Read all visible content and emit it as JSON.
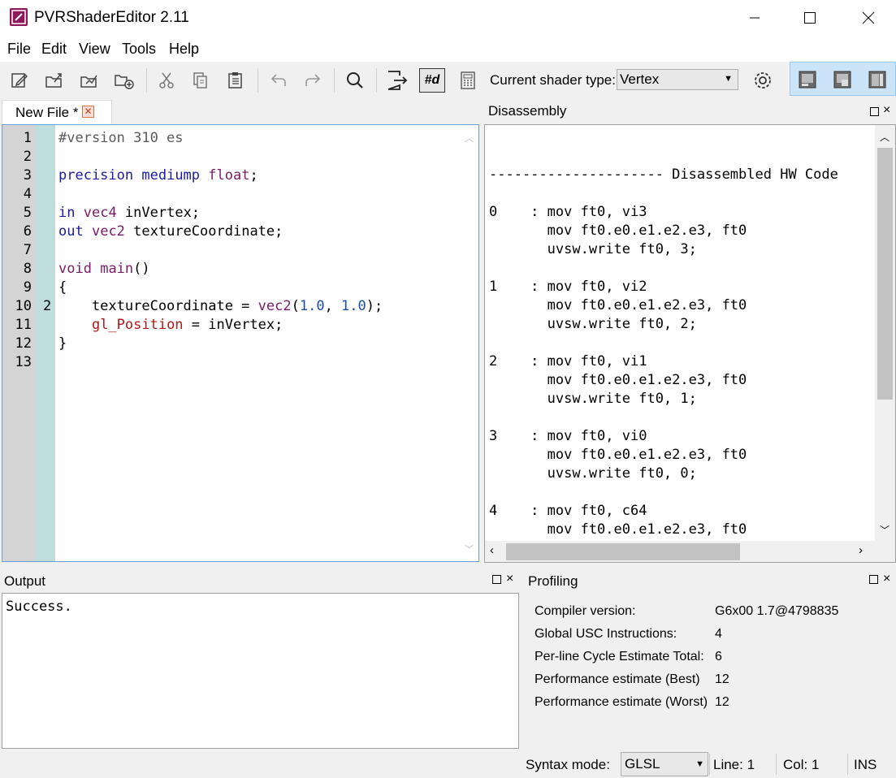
{
  "app": {
    "title": "PVRShaderEditor 2.11"
  },
  "menu": [
    "File",
    "Edit",
    "View",
    "Tools",
    "Help"
  ],
  "toolbar": {
    "icons": [
      "new-file-icon",
      "open-file-icon",
      "open-folder-icon",
      "add-file-icon",
      "cut-icon",
      "copy-icon",
      "paste-icon",
      "undo-icon",
      "redo-icon",
      "search-icon",
      "export-icon",
      "define-icon",
      "calculator-icon",
      "gear-icon",
      "layout-left-icon",
      "layout-split-icon",
      "layout-right-icon"
    ],
    "shader_type_label": "Current shader type:",
    "shader_type_value": "Vertex",
    "define_label": "#d"
  },
  "editor": {
    "tab_label": "New File *",
    "line_numbers": [
      "1",
      "2",
      "3",
      "4",
      "5",
      "6",
      "7",
      "8",
      "9",
      "10",
      "11",
      "12",
      "13"
    ],
    "cycle_marker": {
      "line": "10",
      "value": "2"
    }
  },
  "disassembly": {
    "title": "Disassembled HW Code",
    "panel_title": "Disassembly",
    "header_line": "--------------------- Disassembled HW Code",
    "lines": [
      "0    : mov ft0, vi3",
      "       mov ft0.e0.e1.e2.e3, ft0",
      "       uvsw.write ft0, 3;",
      "",
      "1    : mov ft0, vi2",
      "       mov ft0.e0.e1.e2.e3, ft0",
      "       uvsw.write ft0, 2;",
      "",
      "2    : mov ft0, vi1",
      "       mov ft0.e0.e1.e2.e3, ft0",
      "       uvsw.write ft0, 1;",
      "",
      "3    : mov ft0, vi0",
      "       mov ft0.e0.e1.e2.e3, ft0",
      "       uvsw.write ft0, 0;",
      "",
      "4    : mov ft0, c64",
      "       mov ft0.e0.e1.e2.e3, ft0"
    ]
  },
  "output": {
    "title": "Output",
    "text": "Success."
  },
  "profiling": {
    "title": "Profiling",
    "rows": [
      {
        "label": "Compiler version:",
        "value": "G6x00 1.7@4798835"
      },
      {
        "label": "Global USC Instructions:",
        "value": "4"
      },
      {
        "label": "Per-line Cycle Estimate Total:",
        "value": "6"
      },
      {
        "label": "Performance estimate (Best)",
        "value": "12"
      },
      {
        "label": "Performance estimate (Worst)",
        "value": "12"
      }
    ]
  },
  "statusbar": {
    "syntax_label": "Syntax mode:",
    "syntax_value": "GLSL",
    "line": "Line: 1",
    "col": "Col: 1",
    "mode": "INS"
  },
  "code": {
    "l1": "#version 310 es",
    "l3a": "precision",
    "l3b": "mediump",
    "l3c": "float",
    "l3d": ";",
    "l5a": "in",
    "l5b": "vec4",
    "l5c": " inVertex;",
    "l6a": "out",
    "l6b": "vec2",
    "l6c": " textureCoordinate;",
    "l8a": "void",
    "l8b": "main",
    "l8c": "()",
    "l9": "{",
    "l10a": "    textureCoordinate = ",
    "l10b": "vec2",
    "l10c": "(",
    "l10d": "1.0",
    "l10e": ", ",
    "l10f": "1.0",
    "l10g": ");",
    "l11a": "    ",
    "l11b": "gl_Position",
    "l11c": " = inVertex;",
    "l12": "}"
  }
}
